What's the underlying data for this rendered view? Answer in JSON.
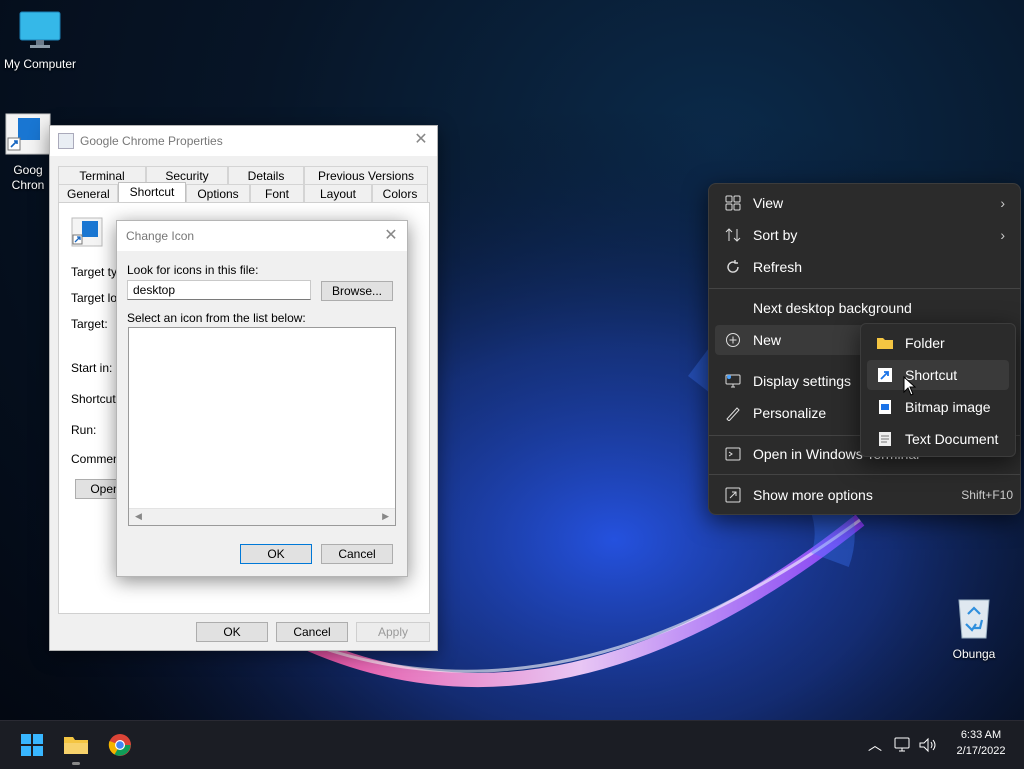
{
  "desktop": {
    "icons": [
      {
        "label": "My Computer"
      },
      {
        "label": "Goog\nChron"
      },
      {
        "label": "Obunga"
      }
    ]
  },
  "properties_window": {
    "title": "Google Chrome Properties",
    "tabs_row1": [
      "Terminal",
      "Security",
      "Details",
      "Previous Versions"
    ],
    "tabs_row2": [
      "General",
      "Shortcut",
      "Options",
      "Font",
      "Layout",
      "Colors"
    ],
    "active_tab": "Shortcut",
    "field_labels": [
      "Target typ",
      "Target loc",
      "Target:",
      "Start in:",
      "Shortcut k",
      "Run:",
      "Comment:"
    ],
    "open_button": "Open",
    "ok": "OK",
    "cancel": "Cancel",
    "apply": "Apply"
  },
  "change_icon_dialog": {
    "title": "Change Icon",
    "look_label": "Look for icons in this file:",
    "file_value": "desktop",
    "browse": "Browse...",
    "select_label": "Select an icon from the list below:",
    "ok": "OK",
    "cancel": "Cancel"
  },
  "context_menu": {
    "items": [
      {
        "label": "View",
        "icon": "grid-icon",
        "submenu": true
      },
      {
        "label": "Sort by",
        "icon": "sort-icon",
        "submenu": true
      },
      {
        "label": "Refresh",
        "icon": "refresh-icon"
      },
      {
        "label": "Next desktop background",
        "icon": ""
      },
      {
        "label": "New",
        "icon": "plus-circle-icon"
      },
      {
        "label": "Display settings",
        "icon": "display-icon"
      },
      {
        "label": "Personalize",
        "icon": "brush-icon"
      },
      {
        "label": "Open in Windows Terminal",
        "icon": "terminal-icon"
      },
      {
        "label": "Show more options",
        "icon": "more-options-icon",
        "shortcut": "Shift+F10"
      }
    ]
  },
  "new_submenu": {
    "items": [
      {
        "label": "Folder",
        "icon": "folder-icon"
      },
      {
        "label": "Shortcut",
        "icon": "shortcut-icon"
      },
      {
        "label": "Bitmap image",
        "icon": "bitmap-icon"
      },
      {
        "label": "Text Document",
        "icon": "text-document-icon"
      }
    ],
    "highlighted": "Shortcut"
  },
  "taskbar": {
    "time": "6:33 AM",
    "date": "2/17/2022",
    "pinned": [
      "start-icon",
      "file-explorer-icon",
      "chrome-icon"
    ]
  },
  "colors": {
    "accent": "#0078d7",
    "menu_bg": "#2b2b2b",
    "taskbar_bg": "#1b1d24"
  }
}
